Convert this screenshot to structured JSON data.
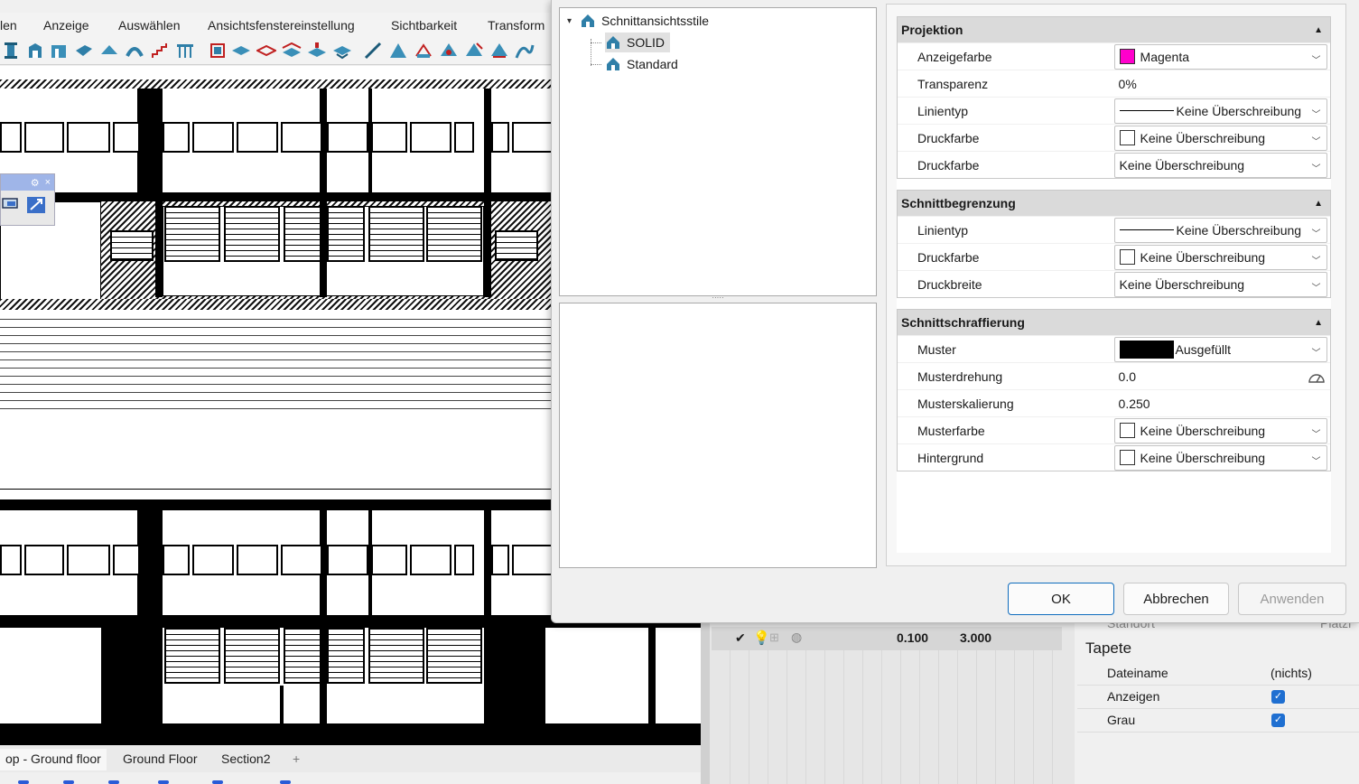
{
  "menubar": [
    "len",
    "Anzeige",
    "Auswählen",
    "Ansichtsfenstereinstellung",
    "Sichtbarkeit",
    "Transform"
  ],
  "view_tabs": [
    "op - Ground floor",
    "Ground Floor",
    "Section2",
    "+"
  ],
  "layer_row": {
    "value1": "0.100",
    "value2": "3.000"
  },
  "right_panel": {
    "clipped_label": "Standort",
    "clipped_value": "Platzi",
    "section_title": "Tapete",
    "rows": [
      {
        "label": "Dateiname",
        "value": "(nichts)"
      },
      {
        "label": "Anzeigen",
        "checked": true
      },
      {
        "label": "Grau",
        "checked": true
      }
    ]
  },
  "dialog": {
    "tree": {
      "root": "Schnittansichtsstile",
      "children": [
        "SOLID",
        "Standard"
      ],
      "selected": "SOLID"
    },
    "sections": [
      {
        "title": "Projektion",
        "rows": [
          {
            "label": "Anzeigefarbe",
            "kind": "color",
            "swatch": "#ff00cc",
            "value": "Magenta"
          },
          {
            "label": "Transparenz",
            "kind": "text",
            "value": "0%"
          },
          {
            "label": "Linientyp",
            "kind": "line",
            "value": "Keine Überschreibung"
          },
          {
            "label": "Druckfarbe",
            "kind": "color",
            "swatch": "#ffffff",
            "value": "Keine Überschreibung"
          },
          {
            "label": "Druckfarbe",
            "kind": "combo",
            "value": "Keine Überschreibung"
          }
        ]
      },
      {
        "title": "Schnittbegrenzung",
        "rows": [
          {
            "label": "Linientyp",
            "kind": "line",
            "value": "Keine Überschreibung"
          },
          {
            "label": "Druckfarbe",
            "kind": "color",
            "swatch": "#ffffff",
            "value": "Keine Überschreibung"
          },
          {
            "label": "Druckbreite",
            "kind": "combo",
            "value": "Keine Überschreibung"
          }
        ]
      },
      {
        "title": "Schnittschraffierung",
        "rows": [
          {
            "label": "Muster",
            "kind": "fill",
            "value": "Ausgefüllt"
          },
          {
            "label": "Musterdrehung",
            "kind": "angle",
            "value": "0.0"
          },
          {
            "label": "Musterskalierung",
            "kind": "text",
            "value": "0.250"
          },
          {
            "label": "Musterfarbe",
            "kind": "color",
            "swatch": "#ffffff",
            "value": "Keine Überschreibung"
          },
          {
            "label": "Hintergrund",
            "kind": "color",
            "swatch": "#ffffff",
            "value": "Keine Überschreibung"
          }
        ]
      }
    ],
    "buttons": {
      "ok": "OK",
      "cancel": "Abbrechen",
      "apply": "Anwenden"
    }
  },
  "colors": {
    "accent": "#0f6cbd",
    "checkbox": "#1f6fd1",
    "magenta": "#ff00cc"
  }
}
